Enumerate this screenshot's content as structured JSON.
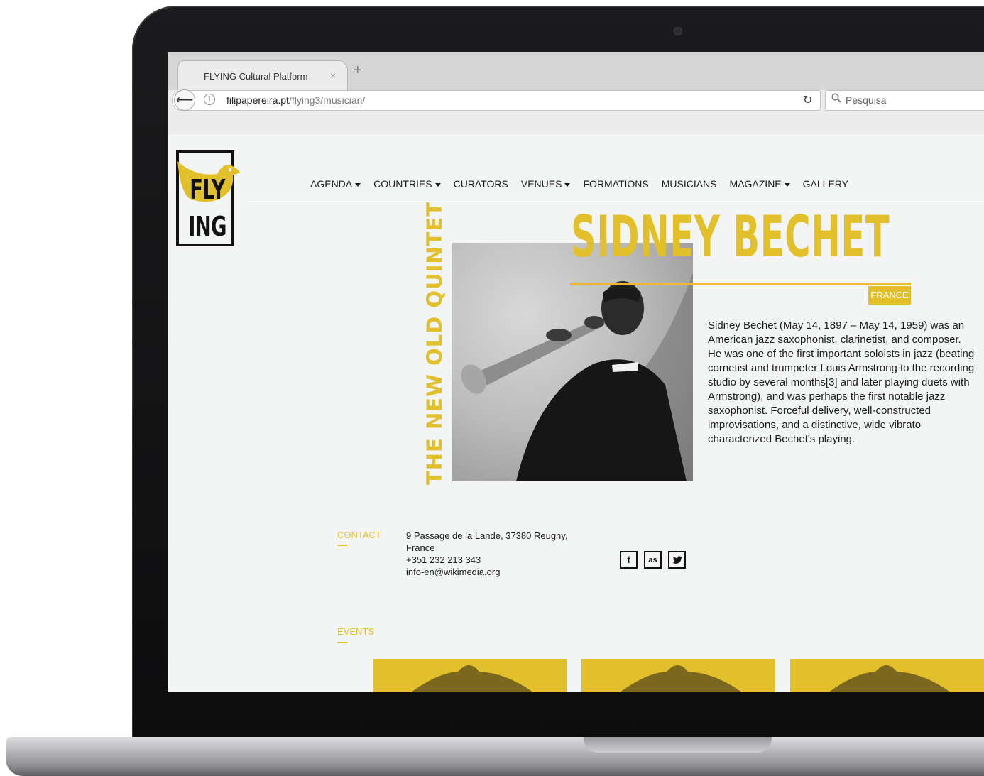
{
  "browser": {
    "tab_title": "FLYING Cultural Platform",
    "tab_close": "×",
    "new_tab": "+",
    "url_domain": "filipapereira.pt",
    "url_path": "/flying3/musician/",
    "search_placeholder": "Pesquisa"
  },
  "logo": {
    "line1": "FLY",
    "line2": "ING"
  },
  "nav": {
    "items": [
      {
        "label": "AGENDA",
        "dropdown": true
      },
      {
        "label": "COUNTRIES",
        "dropdown": true
      },
      {
        "label": "CURATORS",
        "dropdown": false
      },
      {
        "label": "VENUES",
        "dropdown": true
      },
      {
        "label": "FORMATIONS",
        "dropdown": false
      },
      {
        "label": "MUSICIANS",
        "dropdown": false
      },
      {
        "label": "MAGAZINE",
        "dropdown": true
      },
      {
        "label": "GALLERY",
        "dropdown": false
      }
    ]
  },
  "musician": {
    "name": "SIDNEY BECHET",
    "country": "FRANCE",
    "formation": "THE NEW OLD QUINTET",
    "bio": "Sidney Bechet (May 14, 1897 – May 14, 1959) was an American jazz saxophonist, clarinetist, and composer. He was one of the first important soloists in jazz (beating cornetist and trumpeter Louis Armstrong to the recording studio by several months[3] and later playing duets with Armstrong), and was perhaps the first notable jazz saxophonist. Forceful delivery, well-constructed improvisations, and a distinctive, wide vibrato characterized Bechet's playing."
  },
  "contact": {
    "label": "CONTACT",
    "address": "9 Passage de la Lande, 37380 Reugny, France",
    "phone": "+351 232 213 343",
    "email": "info-en@wikimedia.org"
  },
  "social": [
    {
      "icon": "facebook-icon",
      "glyph": "f"
    },
    {
      "icon": "lastfm-icon",
      "glyph": "as"
    },
    {
      "icon": "twitter-icon",
      "glyph": "t"
    }
  ],
  "events": {
    "label": "EVENTS",
    "card_count": 3
  },
  "colors": {
    "accent": "#e2c02c",
    "page_bg": "#f2f5f3",
    "text": "#1c1c1c"
  }
}
